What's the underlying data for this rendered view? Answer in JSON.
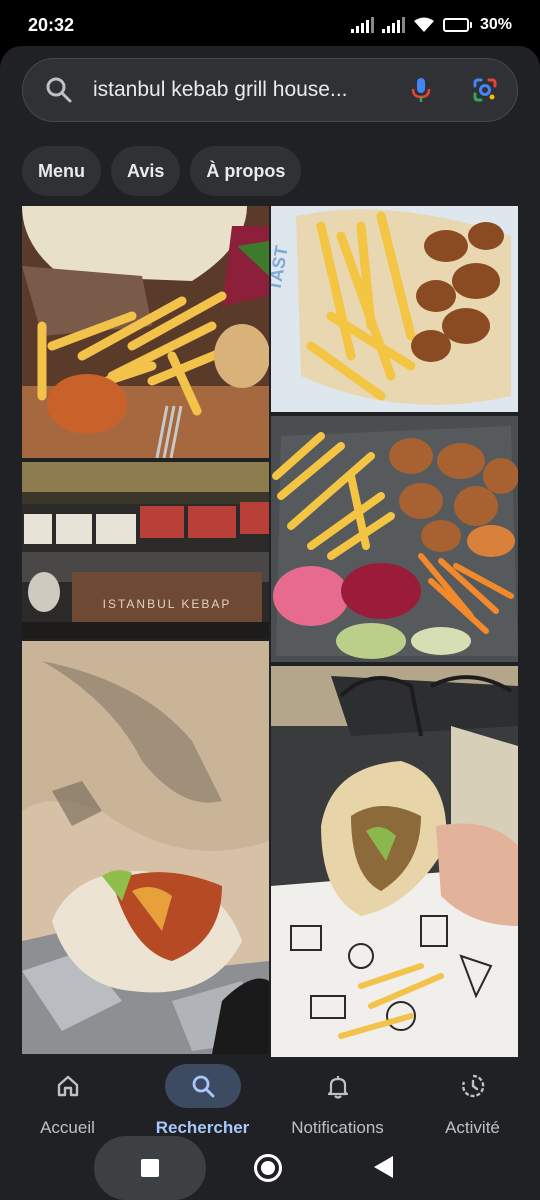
{
  "status_bar": {
    "time": "20:32",
    "battery": "30%"
  },
  "search": {
    "query": "istanbul kebab grill house..."
  },
  "chips": [
    "Menu",
    "Avis",
    "À propos"
  ],
  "photos": {
    "sign_text": "ISTANBUL KEBAP"
  },
  "nav": {
    "items": [
      {
        "label": "Accueil",
        "icon": "home-icon"
      },
      {
        "label": "Rechercher",
        "icon": "search-icon"
      },
      {
        "label": "Notifications",
        "icon": "bell-icon"
      },
      {
        "label": "Activité",
        "icon": "activity-icon"
      }
    ],
    "active": "Rechercher",
    "accent_color": "#a8c7fa"
  },
  "system_nav": [
    "recents-button",
    "home-button",
    "back-button"
  ]
}
